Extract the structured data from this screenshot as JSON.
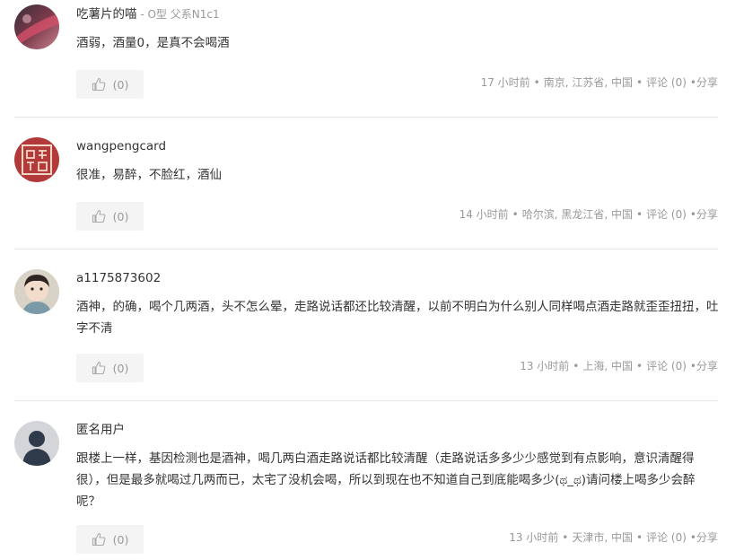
{
  "comments": [
    {
      "username": "吃薯片的喵",
      "sep": " - ",
      "tags": "O型 父系N1c1",
      "body": "酒弱，酒量0，是真不会喝酒",
      "like_label": "(0)",
      "time": "17 小时前",
      "location": "南京, 江苏省, 中国",
      "comment_label": "评论 (0)",
      "share_label": "分享"
    },
    {
      "username": "wangpengcard",
      "body": "很准，易醉，不脸红，酒仙",
      "like_label": "(0)",
      "time": "14 小时前",
      "location": "哈尔滨, 黑龙江省, 中国",
      "comment_label": "评论 (0)",
      "share_label": "分享"
    },
    {
      "username": "a1175873602",
      "body": "酒神，的确，喝个几两酒，头不怎么晕，走路说话都还比较清醒，以前不明白为什么别人同样喝点酒走路就歪歪扭扭，吐字不清",
      "like_label": "(0)",
      "time": "13 小时前",
      "location": "上海, 中国",
      "comment_label": "评论 (0)",
      "share_label": "分享"
    },
    {
      "username": "匿名用户",
      "body": "跟楼上一样，基因检测也是酒神，喝几两白酒走路说话都比较清醒（走路说话多多少少感觉到有点影响，意识清醒得很），但是最多就喝过几两而已，太宅了没机会喝，所以到现在也不知道自己到底能喝多少(ಥ_ಥ)请问楼上喝多少会醉呢？",
      "like_label": "(0)",
      "time": "13 小时前",
      "location": "天津市, 中国",
      "comment_label": "评论 (0)",
      "share_label": "分享"
    }
  ],
  "colors": {
    "text": "#333333",
    "muted": "#999999",
    "button_bg": "#f4f4f4",
    "divider": "#e8e8e8"
  }
}
